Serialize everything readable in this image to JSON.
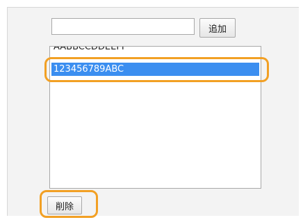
{
  "form": {
    "input_value": "",
    "add_label": "追加",
    "delete_label": "削除"
  },
  "list": {
    "items": [
      {
        "label": "AABBCCDDEEFF",
        "selected": false
      },
      {
        "label": "123456789ABC",
        "selected": true
      }
    ]
  },
  "colors": {
    "selection": "#3b8ef0",
    "highlight": "#f2a024",
    "panel": "#f3f3f3"
  }
}
